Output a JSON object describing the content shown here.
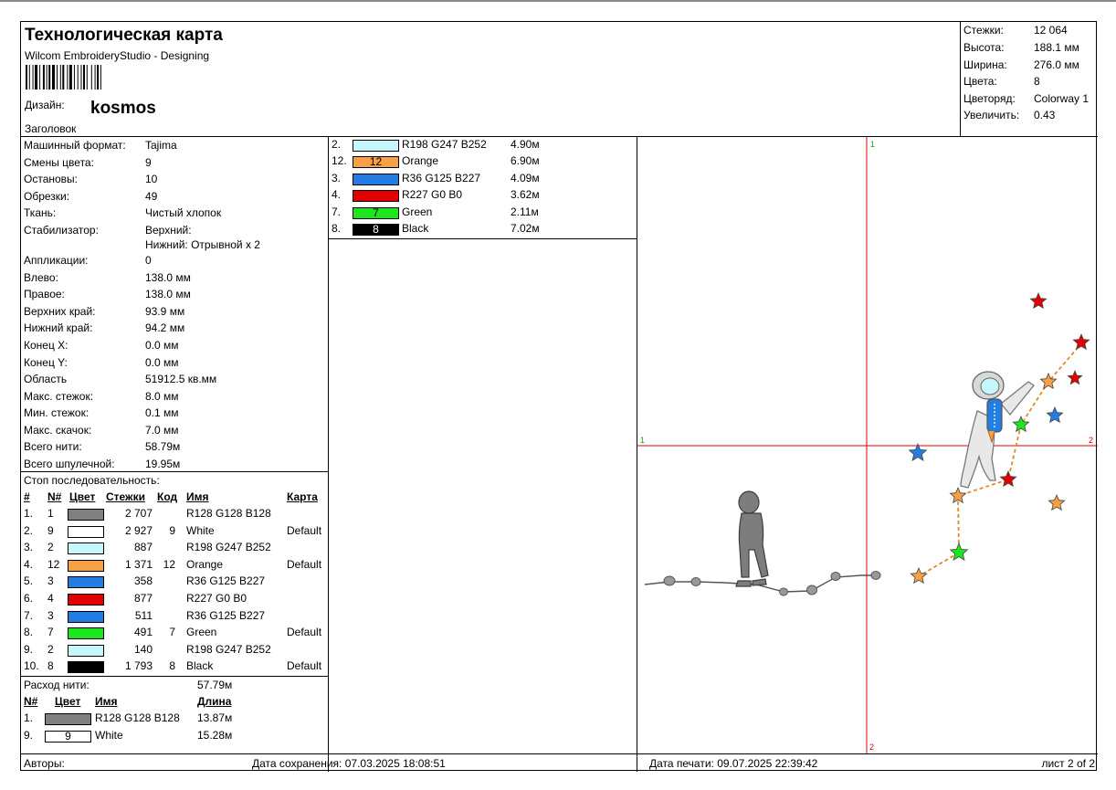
{
  "header": {
    "title": "Технологическая карта",
    "subtitle": "Wilcom EmbroideryStudio - Designing",
    "design_label": "Дизайн:",
    "design_name": "kosmos",
    "caption": "Заголовок"
  },
  "summary": [
    {
      "label": "Стежки:",
      "value": "12 064"
    },
    {
      "label": "Высота:",
      "value": "188.1 мм"
    },
    {
      "label": "Ширина:",
      "value": "276.0 мм"
    },
    {
      "label": "Цвета:",
      "value": "8"
    },
    {
      "label": "Цветоряд:",
      "value": "Colorway 1"
    },
    {
      "label": "Увеличить:",
      "value": "0.43"
    }
  ],
  "params": [
    {
      "label": "Машинный формат:",
      "value": "Tajima"
    },
    {
      "label": "Смены цвета:",
      "value": "9"
    },
    {
      "label": "Остановы:",
      "value": "10"
    },
    {
      "label": "Обрезки:",
      "value": "49"
    },
    {
      "label": "Ткань:",
      "value": "Чистый хлопок"
    },
    {
      "label": "Стабилизатор:",
      "value": "Верхний:",
      "value2": "Нижний: Отрывной x 2"
    },
    {
      "label": "Аппликации:",
      "value": "0"
    },
    {
      "label": "Влево:",
      "value": "138.0 мм"
    },
    {
      "label": "Правое:",
      "value": "138.0 мм"
    },
    {
      "label": "Верхних край:",
      "value": "93.9 мм"
    },
    {
      "label": "Нижний край:",
      "value": "94.2 мм"
    },
    {
      "label": "Конец X:",
      "value": "0.0 мм"
    },
    {
      "label": "Конец Y:",
      "value": "0.0 мм"
    },
    {
      "label": "Область",
      "value": "51912.5 кв.мм"
    },
    {
      "label": "Макс. стежок:",
      "value": "8.0 мм"
    },
    {
      "label": "Мин. стежок:",
      "value": "0.1 мм"
    },
    {
      "label": "Макс. скачок:",
      "value": "7.0 мм"
    },
    {
      "label": "Всего нити:",
      "value": "58.79м"
    },
    {
      "label": "Всего шпулечной:",
      "value": "19.95м"
    }
  ],
  "stop_sequence": {
    "title": "Стоп последовательность:",
    "headers": {
      "num": "#",
      "n": "N#",
      "color": "Цвет",
      "stitches": "Стежки",
      "code": "Код",
      "name": "Имя",
      "chart": "Карта"
    },
    "rows": [
      {
        "num": "1.",
        "n": "1",
        "color": "#808080",
        "label": "",
        "stitches": "2 707",
        "code": "",
        "name": "R128 G128 B128",
        "chart": ""
      },
      {
        "num": "2.",
        "n": "9",
        "color": "#ffffff",
        "label": "",
        "stitches": "2 927",
        "code": "9",
        "name": "White",
        "chart": "Default"
      },
      {
        "num": "3.",
        "n": "2",
        "color": "#c6f7fc",
        "label": "",
        "stitches": "887",
        "code": "",
        "name": "R198 G247 B252",
        "chart": ""
      },
      {
        "num": "4.",
        "n": "12",
        "color": "#f7a045",
        "label": "",
        "stitches": "1 371",
        "code": "12",
        "name": "Orange",
        "chart": "Default"
      },
      {
        "num": "5.",
        "n": "3",
        "color": "#247de3",
        "label": "",
        "stitches": "358",
        "code": "",
        "name": "R36 G125 B227",
        "chart": ""
      },
      {
        "num": "6.",
        "n": "4",
        "color": "#e30000",
        "label": "",
        "stitches": "877",
        "code": "",
        "name": "R227 G0 B0",
        "chart": ""
      },
      {
        "num": "7.",
        "n": "3",
        "color": "#247de3",
        "label": "",
        "stitches": "511",
        "code": "",
        "name": "R36 G125 B227",
        "chart": ""
      },
      {
        "num": "8.",
        "n": "7",
        "color": "#1ee61e",
        "label": "",
        "stitches": "491",
        "code": "7",
        "name": "Green",
        "chart": "Default"
      },
      {
        "num": "9.",
        "n": "2",
        "color": "#c6f7fc",
        "label": "",
        "stitches": "140",
        "code": "",
        "name": "R198 G247 B252",
        "chart": ""
      },
      {
        "num": "10.",
        "n": "8",
        "color": "#000000",
        "label": "",
        "stitches": "1 793",
        "code": "8",
        "name": "Black",
        "chart": "Default"
      }
    ]
  },
  "thread_usage": {
    "label": "Расход нити:",
    "total": "57.79м",
    "headers": {
      "n": "N#",
      "color": "Цвет",
      "name": "Имя",
      "length": "Длина"
    },
    "rows": [
      {
        "n": "1.",
        "color": "#808080",
        "label": "",
        "text_color": "#000000",
        "name": "R128 G128 B128",
        "length": "13.87м"
      },
      {
        "n": "9.",
        "color": "#ffffff",
        "label": "9",
        "text_color": "#000000",
        "name": "White",
        "length": "15.28м"
      },
      {
        "n": "2.",
        "color": "#c6f7fc",
        "label": "",
        "text_color": "#000000",
        "name": "R198 G247 B252",
        "length": "4.90м"
      },
      {
        "n": "12.",
        "color": "#f7a045",
        "label": "12",
        "text_color": "#000000",
        "name": "Orange",
        "length": "6.90м"
      },
      {
        "n": "3.",
        "color": "#247de3",
        "label": "",
        "text_color": "#000000",
        "name": "R36 G125 B227",
        "length": "4.09м"
      },
      {
        "n": "4.",
        "color": "#e30000",
        "label": "",
        "text_color": "#000000",
        "name": "R227 G0 B0",
        "length": "3.62м"
      },
      {
        "n": "7.",
        "color": "#1ee61e",
        "label": "7",
        "text_color": "#000000",
        "name": "Green",
        "length": "2.11м"
      },
      {
        "n": "8.",
        "color": "#000000",
        "label": "8",
        "text_color": "#ffffff",
        "name": "Black",
        "length": "7.02м"
      }
    ]
  },
  "preview": {
    "marker_top": "1",
    "marker_left": "1",
    "marker_right": "2",
    "marker_bottom": "2",
    "guide_color": "#e00000",
    "marker_color": "#00b000"
  },
  "footer": {
    "authors": "Авторы:",
    "saved": "Дата сохранения: 07.03.2025 18:08:51",
    "printed": "Дата печати: 09.07.2025 22:39:42",
    "page": "лист 2 of 2"
  }
}
